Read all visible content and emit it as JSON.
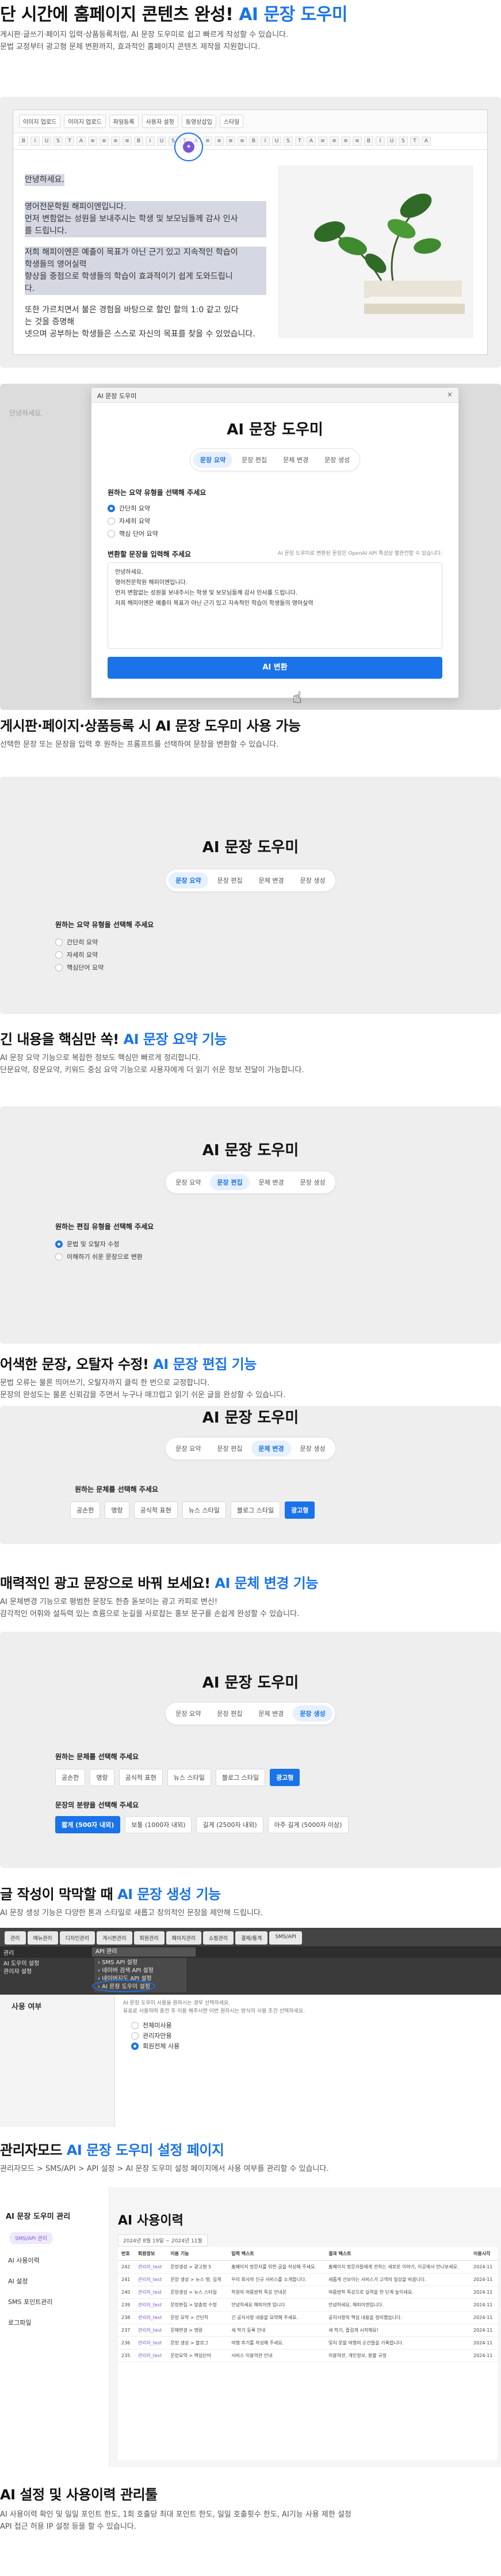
{
  "sec1": {
    "title_pre": "단 시간에 홈페이지 콘텐츠 완성! ",
    "title_accent": "AI 문장 도우미",
    "desc1": "게시판·글쓰기·페이지 입력·상품등록처럼, AI 문장 도우미로 쉽고 빠르게 작성할 수 있습니다.",
    "desc2": "문법 교정부터 광고형 문체 변환까지, 효과적인 홈페이지 콘텐츠 제작을 지원합니다."
  },
  "editor": {
    "tabs": [
      "이미지 업로드",
      "이미지 업로드",
      "파일등록",
      "사용자 설정",
      "동영상삽입",
      "스타일"
    ],
    "toolbar_labels": [
      "B",
      "I",
      "U",
      "S",
      "T",
      "A",
      "≡",
      "≡",
      "≡",
      "≡"
    ],
    "heading": "안녕하세요.",
    "para1": [
      "영어전문학원 해피이엔입니다.",
      "먼저 변함없는 성원을 보내주시는 학생 및 보모님들께 감사 인사",
      "를 드립니다."
    ],
    "para2": [
      "저희 해피이엔은 예출이 목표가 아닌 근기 있고 지속적인 학습이",
      "학생들의 영어실력",
      "향상을 중점으로 학생들의 학습이 효과적이기 쉽게 도와드립니",
      "다."
    ],
    "para3": [
      "또한 가르치면서 불은 경험을 바탕으로 할인 할의 1:0 같고 있다",
      "는 것을 증명해",
      "넷으며 공부하는 학생들은 스스로 자신의 목표를 찾을 수 있었습니다."
    ]
  },
  "dialog": {
    "header": "AI 문장 도우미",
    "title": "AI 문장 도우미",
    "tabs": [
      "문장 요약",
      "문장 편집",
      "문체 변경",
      "문장 생성"
    ],
    "label": "원하는 요약 유형을 선택해 주세요",
    "options": [
      "간단히 요약",
      "자세히 요약",
      "핵심 단어 요약"
    ],
    "text_label": "변환할 문장을 입력해 주세요",
    "notice": "AI 문장 도우미로 변환된 문장은 OpenAI API 특성상 불완전할 수 있습니다.",
    "text_lines": [
      "안녕하세요.",
      "영어전문학원 해피이엔입니다.",
      "먼저 변함없는 성원을 보내주시는 학생 및 보모님들께 감사 인사를 드립니다.",
      "저희 해피이엔은 예출이 목표가 아닌 근기 있고 지속적인 학습이 학생들의 영어실력"
    ],
    "button": "AI 변환"
  },
  "sec2": {
    "title": "게시판·페이지·상품등록 시 AI 문장 도우미 사용 가능",
    "desc": "선택한 문장 또는 문장을 입력 후 원하는 프롬프트를 선택하여 문장을 변환할 수 있습니다."
  },
  "panel_summary": {
    "title": "AI 문장 도우미",
    "tabs": [
      "문장 요약",
      "문장 편집",
      "문체 변경",
      "문장 생성"
    ],
    "label": "원하는 요약 유형을 선택해 주세요",
    "options": [
      "간단히 요약",
      "자세히 요약",
      "핵심단어 요약"
    ]
  },
  "sec3": {
    "title_pre": "긴 내용을 핵심만 쏙! ",
    "title_accent": "AI 문장 요약 기능",
    "desc1": "AI 문장 요약 기능으로 복잡한 정보도 핵심만 빠르게 정리합니다.",
    "desc2": "단문요약, 장문요약, 키워드 중심 요약 기능으로 사용자에게 더 읽기 쉬운 정보 전달이 가능합니다."
  },
  "panel_edit": {
    "title": "AI 문장 도우미",
    "tabs": [
      "문장 요약",
      "문장 편집",
      "문체 변경",
      "문장 생성"
    ],
    "label": "원하는 편집 유형을 선택해 주세요",
    "options": [
      "문법 및 오탈자 수정",
      "이해하기 쉬운 문장으로 변환"
    ]
  },
  "sec4": {
    "title_pre": "어색한 문장, 오탈자 수정! ",
    "title_accent": "AI 문장 편집 기능",
    "desc1": "문법 오류는 물론 띄어쓰기, 오탈자까지 클릭 한 번으로 교정합니다.",
    "desc2": "문장의 완성도는 물론 신뢰감을 주면서 누구나 매끄럽고 읽기 쉬운 글을 완성할 수 있습니다."
  },
  "panel_style": {
    "title": "AI 문장 도우미",
    "tabs": [
      "문장 요약",
      "문장 편집",
      "문체 변경",
      "문장 생성"
    ],
    "label": "원하는 문체를 선택해 주세요",
    "chips": [
      "공손한",
      "명랑",
      "공식적 표현",
      "뉴스 스타일",
      "블로그 스타일",
      "광고형"
    ]
  },
  "sec5": {
    "title_pre": "매력적인 광고 문장으로 바꿔 보세요! ",
    "title_accent": "AI 문체 변경 기능",
    "desc1": "AI 문체변경 기능으로 평범한 문장도 한층 돋보이는 광고 카피로 변신!",
    "desc2": "감각적인 어휘와 설득력 있는 흐름으로 눈길을 사로잡는 홍보 문구를 손쉽게 완성할 수 있습니다."
  },
  "panel_gen": {
    "title": "AI 문장 도우미",
    "tabs": [
      "문장 요약",
      "문장 편집",
      "문체 변경",
      "문장 생성"
    ],
    "label": "원하는 문체를 선택해 주세요",
    "chips": [
      "공손한",
      "명랑",
      "공식적 표현",
      "뉴스 스타일",
      "블로그 스타일",
      "광고형"
    ],
    "len_label": "문장의 분량을 선택해 주세요",
    "len_chips": [
      "짧게 (500자 내외)",
      "보통 (1000자 내외)",
      "길게 (2500자 내외)",
      "아주 길게 (5000자 이상)"
    ]
  },
  "sec6": {
    "title_pre": "글 작성이 막막할 때 ",
    "title_accent": "AI 문장 생성 기능",
    "desc": "AI 문장 생성 기능은 다양한 톤과 스타일로 새롭고 창의적인 문장을 제안해 드립니다."
  },
  "admin": {
    "tabs": [
      "관리",
      "메뉴관리",
      "디자인관리",
      "게시판관리",
      "회원관리",
      "페이지관리",
      "쇼핑관리",
      "결제/통계",
      "SMS/API"
    ],
    "side_title": "관리",
    "select_value": "API 관리",
    "dark_items": [
      "AI 도우미 설정",
      "관리자 설정"
    ],
    "menu_items": [
      "SMS API 설정",
      "네이버 검색 API 설정",
      "네이버지도 API 설정",
      "AI 문장 도우미 설정"
    ],
    "use_label": "사용 여부",
    "use_desc1": "AI 문장 도우미 사용을 원하시는 경우 선택하세요.",
    "use_desc2": "유료로 사용하며 충전 후 이용 해주시면 이번 원하시는 방식의 사용 조건 선택하세요.",
    "radios": [
      "전체미사용",
      "관리자만용",
      "회원전체 사용"
    ],
    "radio_on": 2
  },
  "sec7": {
    "title_pre": "관리자모드 ",
    "title_accent": "AI 문장 도우미 설정 페이지",
    "desc": "관리자모드 > SMS/API > API 설정 > AI 문장 도우미 설정 페이지에서 사용 여부를 관리할 수 있습니다."
  },
  "usage": {
    "brand": "AI 문장 도우미 관리",
    "badge": "SMS/API 관리",
    "side_items": [
      "AI 사용이력",
      "AI 설정",
      "SMS 포인트관리",
      "로그파일"
    ],
    "title": "AI 사용이력",
    "filter": "2024년 8월 19일 ~ 2024년 11월",
    "headers": [
      "번호",
      "회원정보",
      "이용 기능",
      "입력 텍스트",
      "결과 텍스트",
      "이용시각"
    ],
    "rows": [
      [
        "242",
        "관리자_test",
        "문장생성 > 광고형 5",
        "홈페이지 방문자를 위한 글을 작성해 주세요.",
        "홈페이지 방문자들에게 전하는 새로운 이야기, 이곳에서 만나보세요.",
        "2024-11"
      ],
      [
        "241",
        "관리자_test",
        "문장 생성 > 뉴스 형, 길게",
        "우리 회사의 신규 서비스를 소개합니다.",
        "새롭게 선보이는 서비스가 고객의 일상을 바꿉니다.",
        "2024-11"
      ],
      [
        "240",
        "관리자_test",
        "문장생성 > 뉴스 스타일",
        "학원의 여름방학 특강 안내문",
        "여름방학 특강으로 실력을 한 단계 높이세요.",
        "2024-11"
      ],
      [
        "239",
        "관리자_test",
        "문장편집 > 맞춤법 수정",
        "안녕하세요 해피이엔 입니다",
        "안녕하세요, 해피이엔입니다.",
        "2024-11"
      ],
      [
        "238",
        "관리자_test",
        "문장 요약 > 간단히",
        "긴 공지사항 내용을 요약해 주세요.",
        "공지사항의 핵심 내용을 정리했습니다.",
        "2024-11"
      ],
      [
        "237",
        "관리자_test",
        "문체변경 > 명랑",
        "새 학기 등록 안내",
        "새 학기, 즐겁게 시작해요!",
        "2024-11"
      ],
      [
        "236",
        "관리자_test",
        "문장 생성 > 블로그",
        "여행 후기를 작성해 주세요.",
        "잊지 못할 여행의 순간들을 기록합니다.",
        "2024-11"
      ],
      [
        "235",
        "관리자_test",
        "문장요약 > 핵심단어",
        "서비스 이용약관 안내",
        "이용약관, 개인정보, 환불 규정",
        "2024-11"
      ]
    ]
  },
  "sec8": {
    "title": "AI 설정 및 사용이력 관리툴",
    "desc1": "AI 사용이력 확인 및 일일 포인트 한도, 1회 호출당 최대 포인트 한도, 일일 호출횟수 한도, AI기능 사용 제한 설정",
    "desc2": "API 접근 허용 IP 설정 등을 할 수 있습니다."
  }
}
